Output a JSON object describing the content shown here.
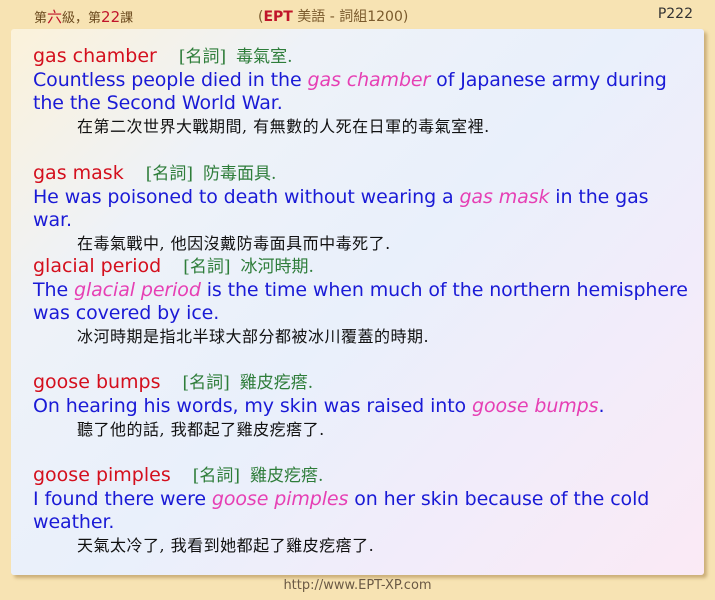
{
  "header": {
    "lesson_prefix": "第",
    "lesson_num_1": "六",
    "lesson_mid": "級，第",
    "lesson_num_2": "22",
    "lesson_suffix": "課",
    "center_open": "(",
    "center_brand": "EPT",
    "center_text": " 美語 - 詞組1200)",
    "page": "P222"
  },
  "entries": [
    {
      "term": "gas chamber",
      "pos": "[名詞]",
      "meaning": "毒氣室.",
      "s_before": "Countless people died in the ",
      "s_hl": "gas chamber",
      "s_after": " of Japanese army during the the Second World War.",
      "translation": "在第二次世界大戰期間, 有無數的人死在日軍的毒氣室裡."
    },
    {
      "term": "gas mask",
      "pos": "[名詞]",
      "meaning": "防毒面具.",
      "s_before": "He was poisoned to death without wearing a ",
      "s_hl": "gas mask",
      "s_after": " in the gas war.",
      "translation": "在毒氣戰中, 他因沒戴防毒面具而中毒死了."
    },
    {
      "term": "glacial period",
      "pos": "[名詞]",
      "meaning": "冰河時期.",
      "s_before": "The ",
      "s_hl": "glacial period",
      "s_after": " is the time when much of the northern hemisphere was covered by ice.",
      "translation": "冰河時期是指北半球大部分都被冰川覆蓋的時期."
    },
    {
      "term": "goose bumps",
      "pos": "[名詞]",
      "meaning": "雞皮疙瘩.",
      "s_before": "On hearing his words, my skin was raised into ",
      "s_hl": "goose bumps",
      "s_after": ".",
      "translation": "聽了他的話, 我都起了雞皮疙瘩了."
    },
    {
      "term": "goose pimples",
      "pos": "[名詞]",
      "meaning": "雞皮疙瘩.",
      "s_before": "I found there were ",
      "s_hl": "goose pimples",
      "s_after": " on her skin because of the cold weather.",
      "translation": "天氣太冷了, 我看到她都起了雞皮疙瘩了."
    }
  ],
  "footer": {
    "url": "http://www.EPT-XP.com"
  }
}
